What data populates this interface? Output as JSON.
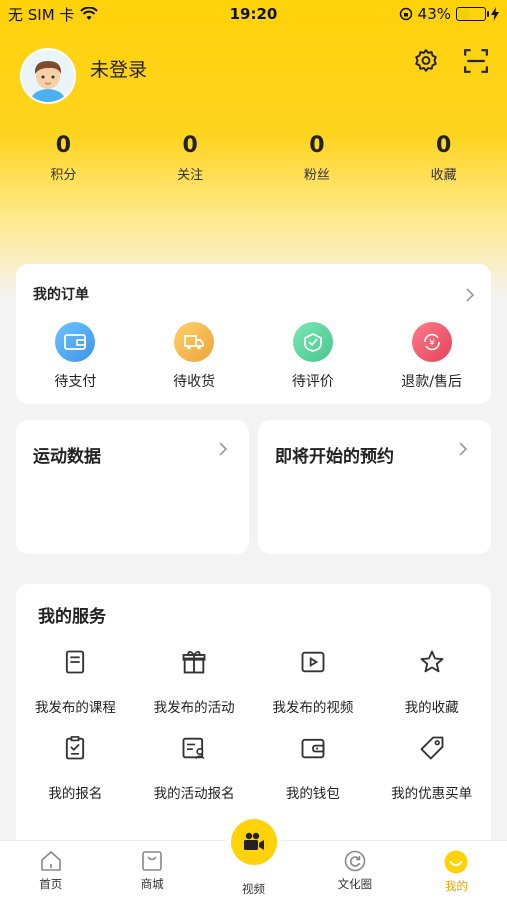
{
  "status_bar": {
    "carrier": "无 SIM 卡",
    "time": "19:20",
    "battery": "43%",
    "battery_level": 0.43
  },
  "profile": {
    "name": "未登录"
  },
  "stats": [
    {
      "value": "0",
      "label": "积分"
    },
    {
      "value": "0",
      "label": "关注"
    },
    {
      "value": "0",
      "label": "粉丝"
    },
    {
      "value": "0",
      "label": "收藏"
    }
  ],
  "orders": {
    "title": "我的订单",
    "items": [
      {
        "label": "待支付",
        "icon": "wallet-icon",
        "color": "#4aa8f0"
      },
      {
        "label": "待收货",
        "icon": "truck-icon",
        "color": "#f2b33d"
      },
      {
        "label": "待评价",
        "icon": "review-icon",
        "color": "#5fd39a"
      },
      {
        "label": "退款/售后",
        "icon": "refund-icon",
        "color": "#f0576a"
      }
    ]
  },
  "sport": {
    "title": "运动数据"
  },
  "appointment": {
    "title": "即将开始的预约"
  },
  "services": {
    "title": "我的服务",
    "items": [
      {
        "label": "我发布的课程",
        "icon": "course-icon"
      },
      {
        "label": "我发布的活动",
        "icon": "gift-icon"
      },
      {
        "label": "我发布的视频",
        "icon": "video-icon"
      },
      {
        "label": "我的收藏",
        "icon": "star-icon"
      },
      {
        "label": "我的报名",
        "icon": "clipboard-icon"
      },
      {
        "label": "我的活动报名",
        "icon": "form-icon"
      },
      {
        "label": "我的钱包",
        "icon": "wallet-icon"
      },
      {
        "label": "我的优惠买单",
        "icon": "tag-icon"
      }
    ]
  },
  "tabbar": [
    {
      "label": "首页",
      "icon": "home-icon"
    },
    {
      "label": "商城",
      "icon": "shop-icon"
    },
    {
      "label": "视频",
      "icon": "camera-icon"
    },
    {
      "label": "文化圈",
      "icon": "circle-icon"
    },
    {
      "label": "我的",
      "icon": "smile-icon"
    }
  ],
  "colors": {
    "accent": "#ffd20a",
    "active_tab": "#e6a400"
  }
}
